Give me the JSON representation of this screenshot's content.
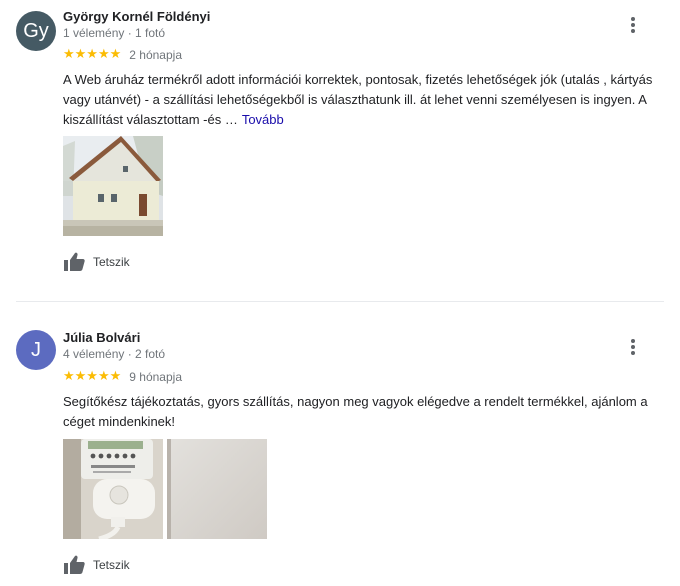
{
  "reviews": [
    {
      "initials": "Gy",
      "avatar_color": "#455a64",
      "name": "György Kornél Földényi",
      "meta": "1 vélemény · 1 fotó",
      "stars": "★★★★★",
      "rating": 5,
      "date": "2 hónapja",
      "text": "A Web áruház termékről adott információi korrektek, pontosak, fizetés lehetőségek jók (utalás , kártyás vagy utánvét) - a szállítási lehetőségekből is választhatunk ill. át lehet venni személyesen is ingyen. A kiszállítást választottam -és …",
      "more_label": "Tovább",
      "like_label": "Tetszik"
    },
    {
      "initials": "J",
      "avatar_color": "#5c6bc0",
      "name": "Júlia Bolvári",
      "meta": "4 vélemény · 2 fotó",
      "stars": "★★★★★",
      "rating": 5,
      "date": "9 hónapja",
      "text": "Segítőkész tájékoztatás, gyors szállítás, nagyon meg vagyok elégedve a rendelt termékkel, ajánlom a céget mindenkinek!",
      "like_label": "Tetszik"
    }
  ],
  "colors": {
    "star": "#fbbc04",
    "link": "#1a0dab",
    "meta": "#70757a"
  }
}
